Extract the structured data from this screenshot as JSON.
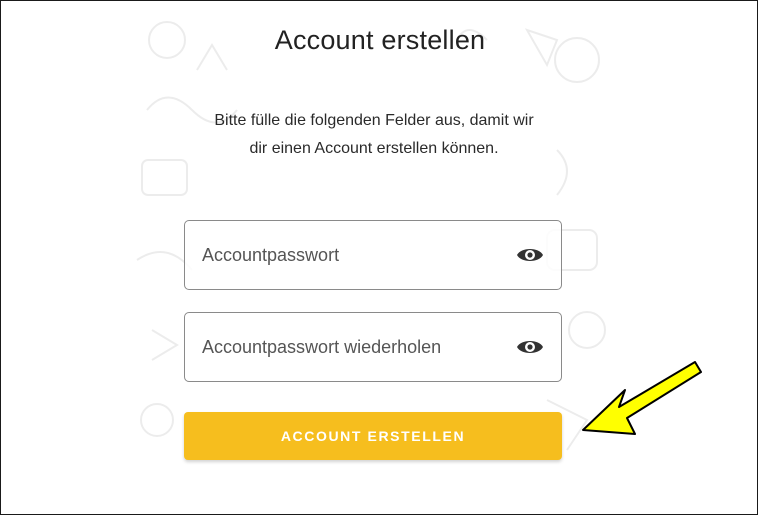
{
  "page": {
    "title": "Account erstellen",
    "subtitle_line1": "Bitte fülle die folgenden Felder aus, damit wir",
    "subtitle_line2": "dir einen Account erstellen können."
  },
  "form": {
    "password": {
      "placeholder": "Accountpasswort",
      "value": "",
      "toggle_icon": "eye-icon"
    },
    "password_repeat": {
      "placeholder": "Accountpasswort wiederholen",
      "value": "",
      "toggle_icon": "eye-icon"
    },
    "submit_label": "ACCOUNT ERSTELLEN"
  },
  "annotation": {
    "icon": "yellow-arrow-pointer",
    "color": "#ffff00"
  },
  "colors": {
    "accent": "#f6be1e",
    "text": "#222222",
    "field_border": "#8a8a8a"
  }
}
